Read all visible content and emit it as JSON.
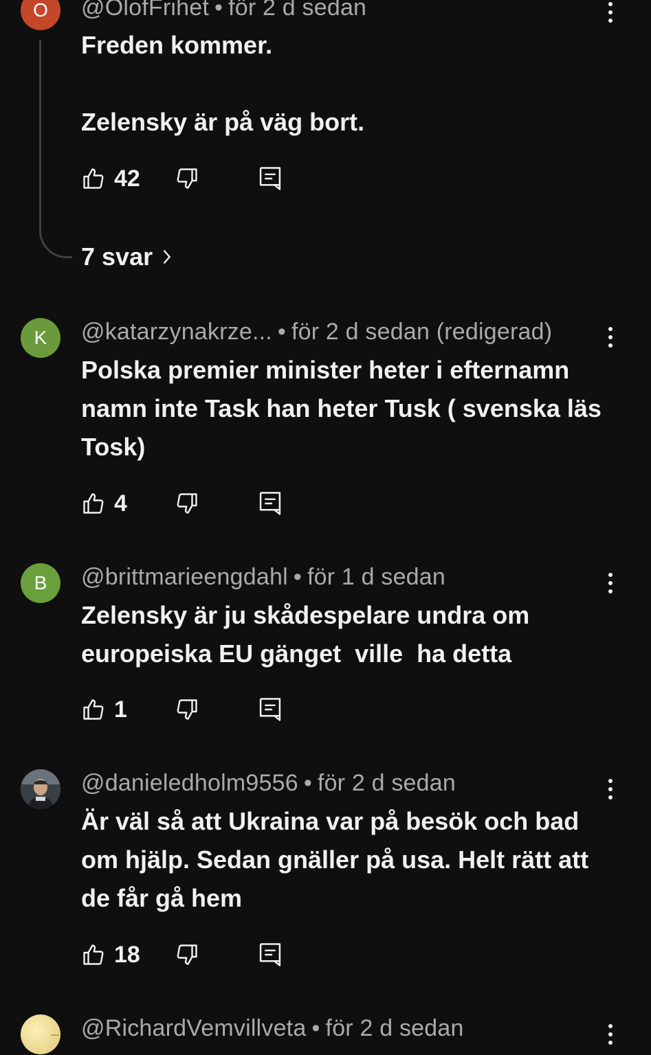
{
  "comments": [
    {
      "avatar_letter": "O",
      "avatar_color": "#c4472a",
      "handle": "@OlofFrihet",
      "time": "för 2 d sedan",
      "text": "Freden kommer.\n\nZelensky är på väg bort.",
      "likes": "42",
      "replies": "7 svar"
    },
    {
      "avatar_letter": "K",
      "avatar_color": "#6a9a3b",
      "handle": "@katarzynakrze...",
      "time": "för 2 d sedan (redigerad)",
      "text": "Polska premier minister heter i efternamn namn inte Task han heter Tusk ( svenska läs Tosk)",
      "likes": "4"
    },
    {
      "avatar_letter": "B",
      "avatar_color": "#6aa03c",
      "handle": "@brittmarieengdahl",
      "time": "för 1 d sedan",
      "text": "Zelensky är ju skådespelare undra om europeiska EU gänget  ville  ha detta",
      "likes": "1"
    },
    {
      "avatar_letter": "",
      "avatar_color": "#4a4f55",
      "handle": "@danieledholm9556",
      "time": "för 2 d sedan",
      "text": "Är väl så att Ukraina var på besök och bad om hjälp. Sedan gnäller på usa. Helt rätt att de får gå hem",
      "likes": "18"
    },
    {
      "avatar_letter": "",
      "avatar_color": "#e8d58a",
      "handle": "@RichardVemvillveta",
      "time": "för 2 d sedan"
    }
  ],
  "separator": "•",
  "icons": {
    "like": "thumbs-up-icon",
    "dislike": "thumbs-down-icon",
    "reply": "comment-reply-icon",
    "more": "more-vertical-icon",
    "chevron": "chevron-right-icon"
  }
}
